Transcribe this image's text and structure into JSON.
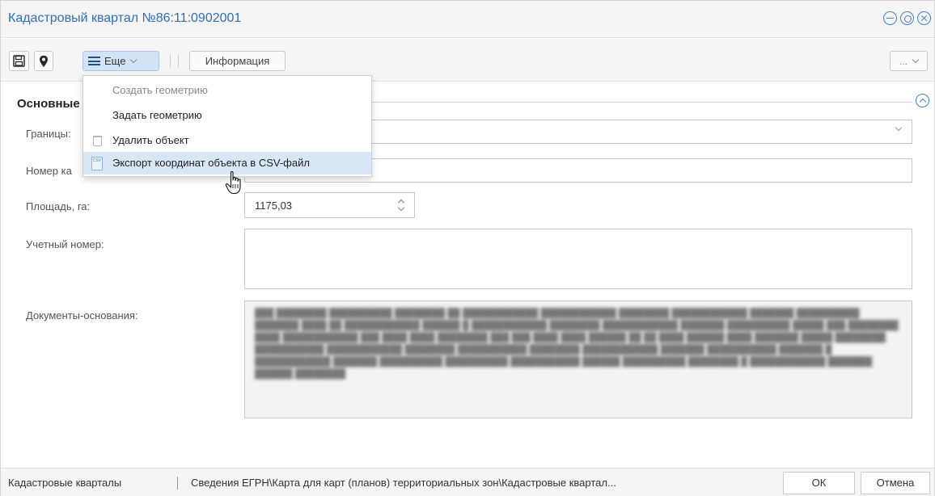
{
  "window": {
    "title": "Кадастровый квартал №86:11:0902001",
    "controls": [
      "minimize",
      "settings",
      "close"
    ]
  },
  "toolbar": {
    "more_label": "Еще",
    "info_label": "Информация",
    "right_label": "..."
  },
  "section": {
    "title": "Основные"
  },
  "fields": {
    "borders_label": "Границы:",
    "number_label": "Номер ка",
    "area_label": "Площадь, га:",
    "area_value": "1175,03",
    "record_label": "Учетный номер:",
    "docs_label": "Документы-основания:"
  },
  "menu": {
    "items": [
      {
        "label": "Создать геометрию",
        "disabled": true
      },
      {
        "label": "Задать геометрию",
        "disabled": false
      },
      {
        "label": "Удалить объект",
        "disabled": false
      },
      {
        "label": "Экспорт координат объекта в CSV-файл",
        "disabled": false,
        "active": true
      }
    ]
  },
  "footer": {
    "layer": "Кадастровые кварталы",
    "path": "Сведения ЕГРН\\Карта для карт (планов) территориальных зон\\Кадастровые квартал...",
    "ok": "ОК",
    "cancel": "Отмена"
  },
  "colors": {
    "title": "#2f6fb6",
    "accent": "#4a7fc3",
    "menu_active": "#d8e6f6",
    "more_button": "#d2e3f6"
  }
}
